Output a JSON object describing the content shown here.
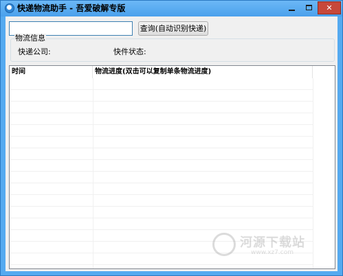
{
  "window": {
    "title": "快递物流助手 - 吾爱破解专版",
    "close_glyph": "✕"
  },
  "query": {
    "input_value": "",
    "button_label": "查询(自动识别快递)"
  },
  "info": {
    "group_title": "物流信息",
    "company_label": "快递公司:",
    "status_label": "快件状态:"
  },
  "table": {
    "columns": [
      "时间",
      "物流进度(双击可以复制单条物流进度)"
    ],
    "rows": []
  },
  "watermark": {
    "text": "河源下载站",
    "url": "www.xz7.com"
  }
}
